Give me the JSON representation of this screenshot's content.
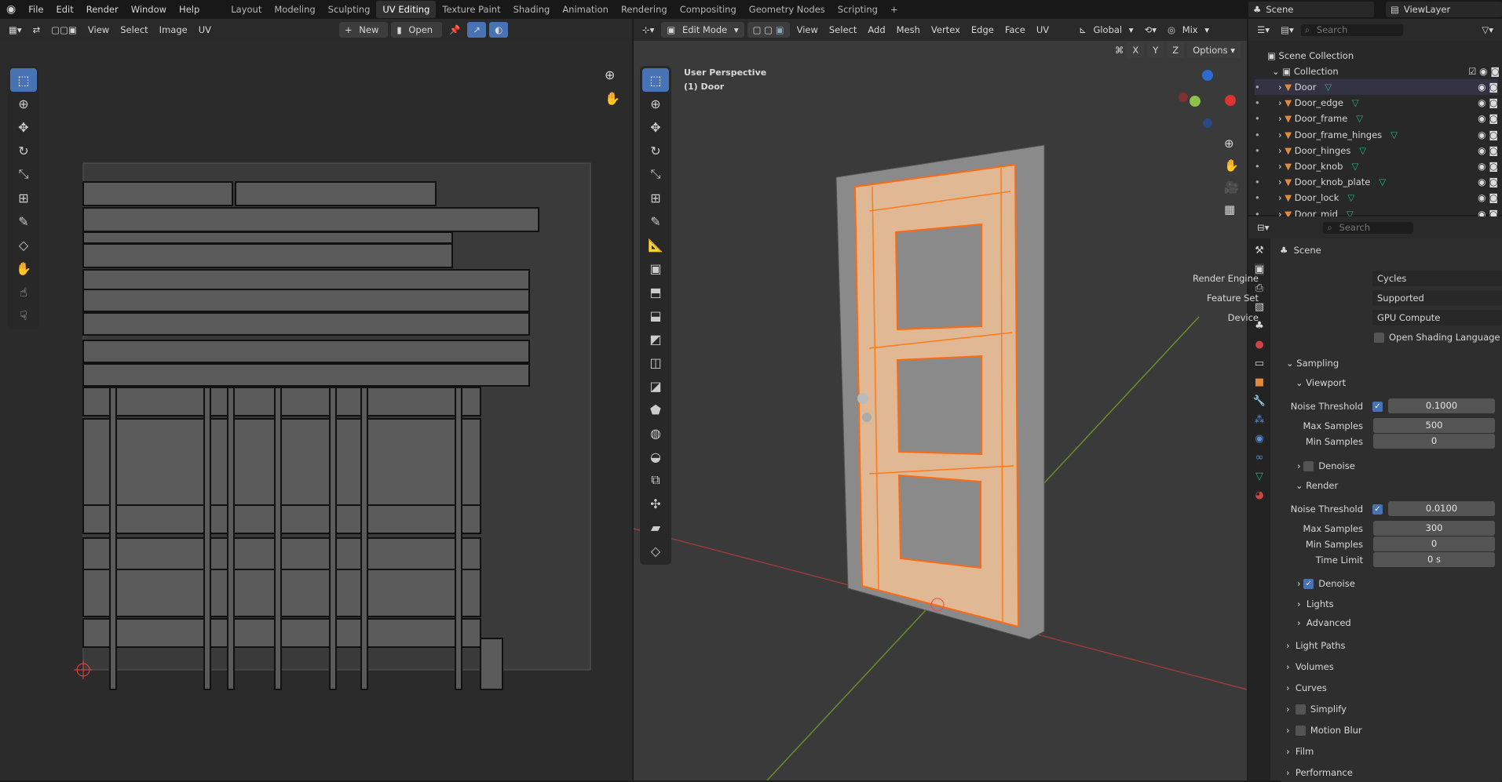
{
  "menu": {
    "items": [
      "File",
      "Edit",
      "Render",
      "Window",
      "Help"
    ]
  },
  "workspaces": [
    "Layout",
    "Modeling",
    "Sculpting",
    "UV Editing",
    "Texture Paint",
    "Shading",
    "Animation",
    "Rendering",
    "Compositing",
    "Geometry Nodes",
    "Scripting"
  ],
  "active_workspace": "UV Editing",
  "scene": {
    "name": "Scene",
    "view_layer": "ViewLayer"
  },
  "uv_editor": {
    "menus": [
      "View",
      "Select",
      "Image",
      "UV"
    ],
    "new_label": "New",
    "open_label": "Open"
  },
  "viewport": {
    "mode": "Edit Mode",
    "menus": [
      "View",
      "Select",
      "Add",
      "Mesh",
      "Vertex",
      "Edge",
      "Face",
      "UV"
    ],
    "orientation": "Global",
    "shading": "Mix",
    "options_label": "Options",
    "axes": [
      "X",
      "Y",
      "Z"
    ],
    "overlay_title": "User Perspective",
    "overlay_object": "(1) Door"
  },
  "outliner": {
    "search_placeholder": "Search",
    "root": "Scene Collection",
    "collection": "Collection",
    "objects": [
      "Door",
      "Door_edge",
      "Door_frame",
      "Door_frame_hinges",
      "Door_hinges",
      "Door_knob",
      "Door_knob_plate",
      "Door_lock",
      "Door_mid"
    ]
  },
  "properties": {
    "search_placeholder": "Search",
    "context": "Scene",
    "render_engine_label": "Render Engine",
    "render_engine": "Cycles",
    "feature_set_label": "Feature Set",
    "feature_set": "Supported",
    "device_label": "Device",
    "device": "GPU Compute",
    "osl_label": "Open Shading Language",
    "sampling": "Sampling",
    "viewport": {
      "title": "Viewport",
      "noise_label": "Noise Threshold",
      "noise": "0.1000",
      "max_label": "Max Samples",
      "max": "500",
      "min_label": "Min Samples",
      "min": "0",
      "denoise": "Denoise"
    },
    "render": {
      "title": "Render",
      "noise_label": "Noise Threshold",
      "noise": "0.0100",
      "max_label": "Max Samples",
      "max": "300",
      "min_label": "Min Samples",
      "min": "0",
      "time_label": "Time Limit",
      "time": "0 s",
      "denoise": "Denoise"
    },
    "subpanels": [
      "Lights",
      "Advanced"
    ],
    "panels": [
      "Light Paths",
      "Volumes",
      "Curves",
      "Simplify",
      "Motion Blur",
      "Film",
      "Performance"
    ]
  },
  "colors": {
    "accent": "#4772b3",
    "selection": "#ff7a1a",
    "mesh": "#1fb58c"
  }
}
